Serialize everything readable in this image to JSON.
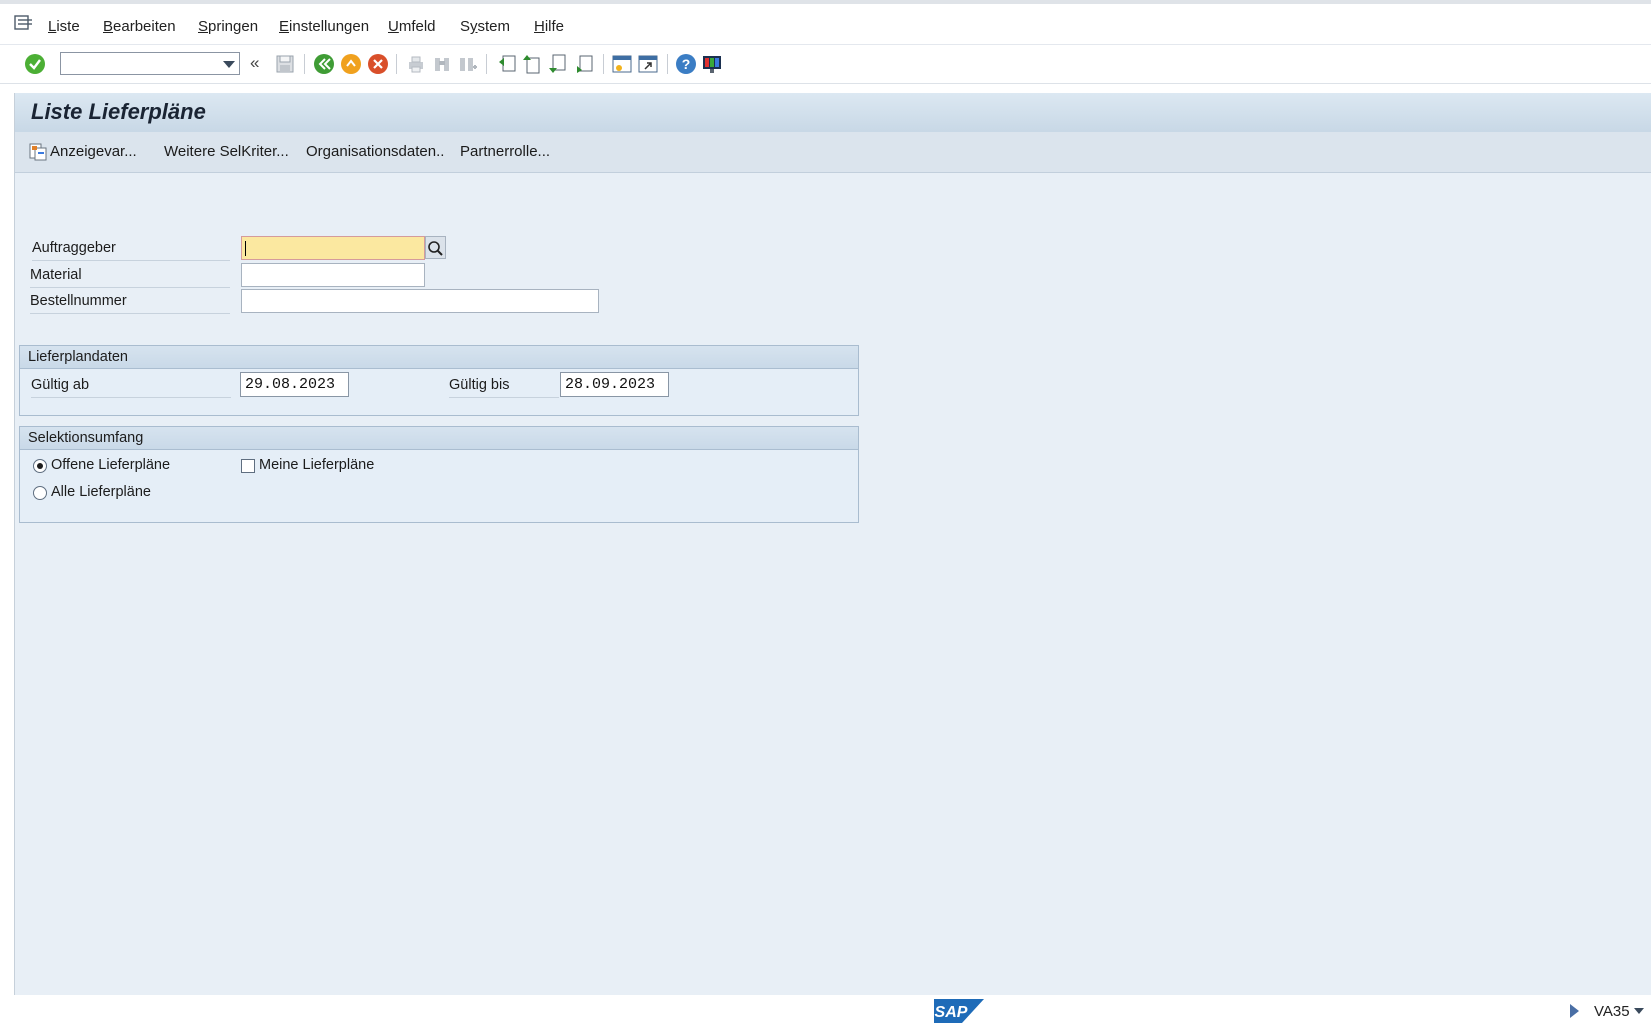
{
  "menu": {
    "items": [
      {
        "label": "Liste",
        "ul": "L"
      },
      {
        "label": "Bearbeiten",
        "ul": "B"
      },
      {
        "label": "Springen",
        "ul": "S"
      },
      {
        "label": "Einstellungen",
        "ul": "E"
      },
      {
        "label": "Umfeld",
        "ul": "U"
      },
      {
        "label": "System",
        "ul": "y"
      },
      {
        "label": "Hilfe",
        "ul": "H"
      }
    ]
  },
  "toolbar": {
    "command_field_value": "",
    "icons": [
      "enter-icon",
      "save-icon",
      "back-icon",
      "exit-icon",
      "cancel-icon",
      "print-icon",
      "find-icon",
      "find-next-icon",
      "first-page-icon",
      "previous-page-icon",
      "next-page-icon",
      "last-page-icon",
      "new-session-icon",
      "create-shortcut-icon",
      "help-icon",
      "customize-layout-icon"
    ]
  },
  "title": "Liste Lieferpläne",
  "app_toolbar": {
    "buttons": [
      "Anzeigevar...",
      "Weitere SelKriter...",
      "Organisationsdaten..",
      "Partnerrolle..."
    ]
  },
  "fields": {
    "auftraggeber": {
      "label": "Auftraggeber",
      "value": ""
    },
    "material": {
      "label": "Material",
      "value": ""
    },
    "bestellnummer": {
      "label": "Bestellnummer",
      "value": ""
    }
  },
  "lieferplandaten": {
    "title": "Lieferplandaten",
    "gueltig_ab_label": "Gültig ab",
    "gueltig_ab_value": "29.08.2023",
    "gueltig_bis_label": "Gültig bis",
    "gueltig_bis_value": "28.09.2023"
  },
  "selektionsumfang": {
    "title": "Selektionsumfang",
    "offene_label": "Offene Lieferpläne",
    "offene_selected": true,
    "alle_label": "Alle Lieferpläne",
    "alle_selected": false,
    "meine_label": "Meine Lieferpläne",
    "meine_checked": false
  },
  "status": {
    "logo_text": "SAP",
    "transaction": "VA35"
  },
  "colors": {
    "main_bg": "#e8eff6",
    "title_bg": "#c8d8e6",
    "focus_field": "#fbe8a0",
    "sap_blue": "#1e6bb8"
  }
}
